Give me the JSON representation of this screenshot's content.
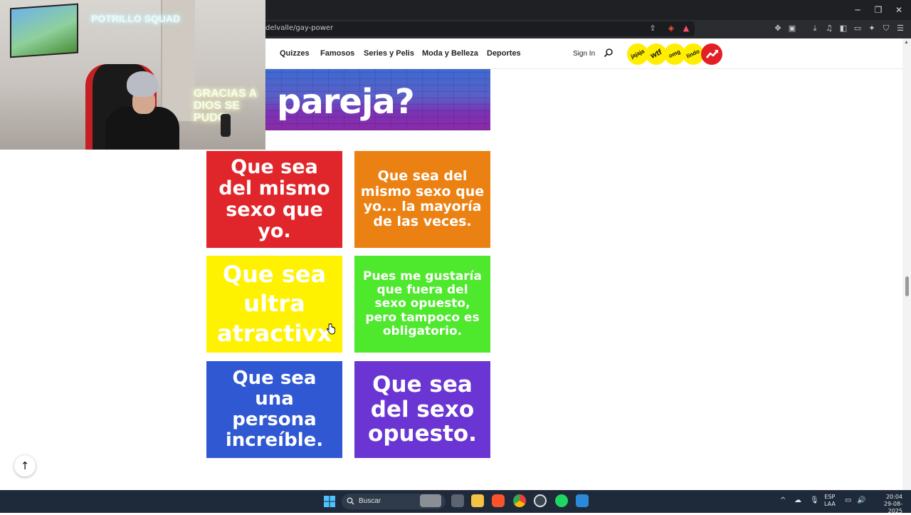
{
  "browser": {
    "url": "delvalle/gay-power",
    "window_controls": {
      "minimize": "─",
      "maximize": "❐",
      "close": "✕"
    }
  },
  "nav": {
    "links": [
      "Quizzes",
      "Famosos",
      "Series y Pelis",
      "Moda y Belleza",
      "Deportes"
    ],
    "sign_in": "Sign In",
    "badges": [
      "jajaja",
      "wtf",
      "omg",
      "lindo"
    ]
  },
  "hero": {
    "text": "pareja?"
  },
  "answers": [
    {
      "text": "Que sea del mismo sexo que yo.",
      "color": "#e0262b"
    },
    {
      "text": "Que sea del mismo sexo que yo... la mayoría de las veces.",
      "color": "#ec8113"
    },
    {
      "text": "Que sea ultra atractivx",
      "color": "#fff200"
    },
    {
      "text": "Pues me gustaría que fuera del sexo opuesto, pero tampoco es obligatorio.",
      "color": "#4ee82d"
    },
    {
      "text": "Que sea una persona increíble.",
      "color": "#2f58d2"
    },
    {
      "text": "Que sea del sexo opuesto.",
      "color": "#6a35d2"
    }
  ],
  "webcam": {
    "neon_top": "POTRILLO SQUAD",
    "neon_bottom": "GRACIAS A DIOS SE PUDO"
  },
  "taskbar": {
    "search_placeholder": "Buscar",
    "lang_top": "ESP",
    "lang_bottom": "LAA",
    "time": "20:04",
    "date": "29-08-2025"
  },
  "icons": {
    "back_to_top": "↑",
    "trending": "trending-icon"
  }
}
